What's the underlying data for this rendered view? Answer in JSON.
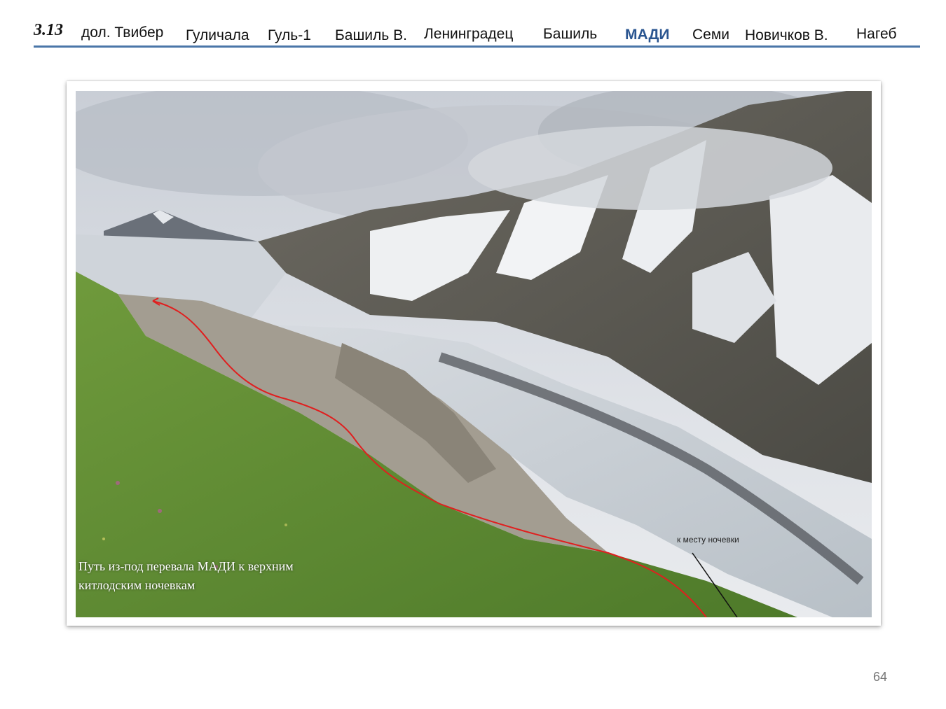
{
  "header": {
    "section_number": "3.13",
    "nav_items": [
      {
        "label": "дол. Твибер",
        "active": false
      },
      {
        "label": "Гуличала",
        "active": false
      },
      {
        "label": "Гуль-1",
        "active": false
      },
      {
        "label": "Башиль В.",
        "active": false
      },
      {
        "label": "Ленинградец",
        "active": false
      },
      {
        "label": "Башиль",
        "active": false
      },
      {
        "label": "МАДИ",
        "active": true
      },
      {
        "label": "Семи",
        "active": false
      },
      {
        "label": "Новичков В.",
        "active": false
      },
      {
        "label": "Нагеб",
        "active": false
      }
    ],
    "accent_color": "#4a76a8"
  },
  "photo": {
    "caption_line1": "Путь из-под перевала МАДИ к верхним",
    "caption_line2": "китлодским ночевкам",
    "annotation": "к месту ночевки",
    "route_color": "#e01f1f"
  },
  "footer": {
    "page_number": "64"
  }
}
